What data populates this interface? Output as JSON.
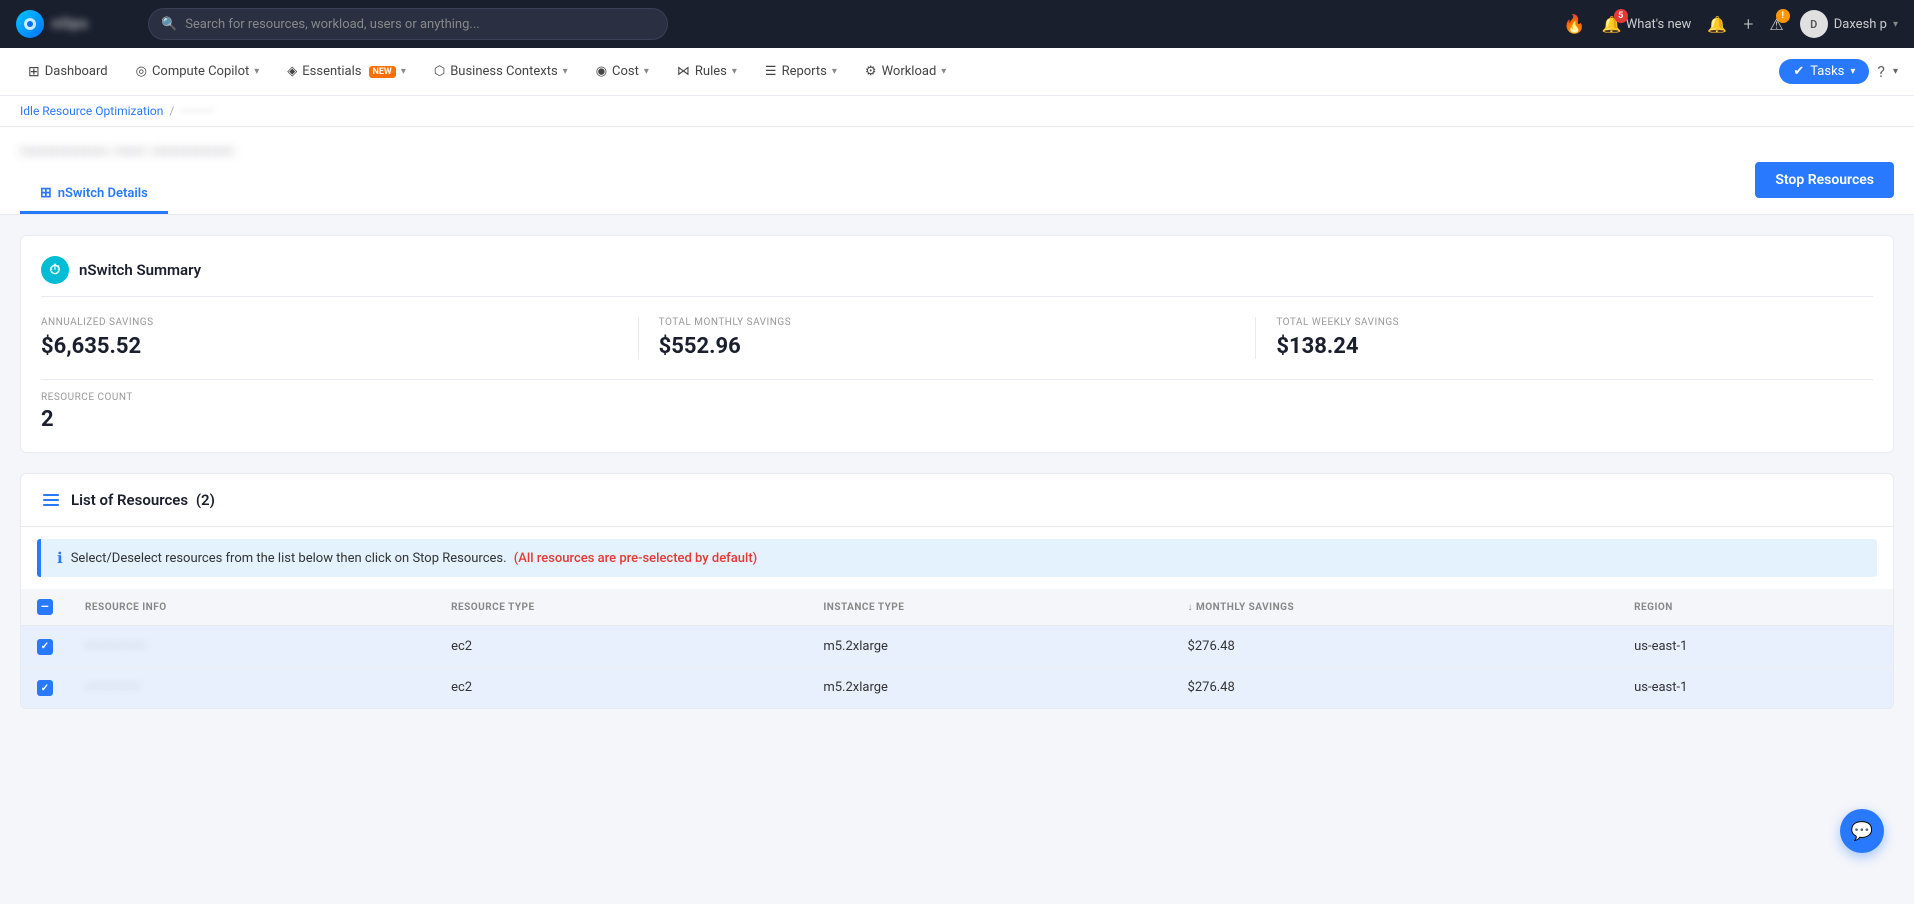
{
  "topNav": {
    "searchPlaceholder": "Search for resources, workload, users or anything...",
    "whatsNew": "What's new",
    "notifBadge": "5",
    "userName": "Daxesh p",
    "tasksLabel": "Tasks"
  },
  "secNav": {
    "items": [
      {
        "id": "dashboard",
        "label": "Dashboard",
        "icon": "⊞",
        "hasDropdown": false,
        "badge": ""
      },
      {
        "id": "compute-copilot",
        "label": "Compute Copilot",
        "icon": "◎",
        "hasDropdown": true,
        "badge": ""
      },
      {
        "id": "essentials",
        "label": "Essentials",
        "icon": "◈",
        "hasDropdown": true,
        "badge": "NEW"
      },
      {
        "id": "business-contexts",
        "label": "Business Contexts",
        "icon": "⬡",
        "hasDropdown": true,
        "badge": ""
      },
      {
        "id": "cost",
        "label": "Cost",
        "icon": "◉",
        "hasDropdown": true,
        "badge": ""
      },
      {
        "id": "rules",
        "label": "Rules",
        "icon": "⋈",
        "hasDropdown": true,
        "badge": ""
      },
      {
        "id": "reports",
        "label": "Reports",
        "icon": "☰",
        "hasDropdown": true,
        "badge": ""
      },
      {
        "id": "workload",
        "label": "Workload",
        "icon": "⚙",
        "hasDropdown": true,
        "badge": ""
      }
    ],
    "tasksLabel": "Tasks"
  },
  "breadcrumb": {
    "parent": "Idle Resource Optimization",
    "current": "···········"
  },
  "pageHeader": {
    "title": "·············· ····· ·············",
    "stopResourcesLabel": "Stop Resources",
    "tab": {
      "icon": "⊞",
      "label": "nSwitch Details"
    }
  },
  "summary": {
    "sectionTitle": "nSwitch Summary",
    "metrics": [
      {
        "label": "ANNUALIZED SAVINGS",
        "value": "$6,635.52"
      },
      {
        "label": "TOTAL MONTHLY SAVINGS",
        "value": "$552.96"
      },
      {
        "label": "TOTAL WEEKLY SAVINGS",
        "value": "$138.24"
      }
    ],
    "resourceCountLabel": "RESOURCE COUNT",
    "resourceCountValue": "2"
  },
  "resources": {
    "sectionTitle": "List of Resources",
    "resourceCount": "(2)",
    "infoBanner": "Select/Deselect resources from the list below then click on Stop Resources.",
    "infoBannerHighlight": "(All resources are pre-selected by default)",
    "tableHeaders": [
      {
        "id": "resource-info",
        "label": "RESOURCE INFO"
      },
      {
        "id": "resource-type",
        "label": "RESOURCE TYPE"
      },
      {
        "id": "instance-type",
        "label": "INSTANCE TYPE"
      },
      {
        "id": "monthly-savings",
        "label": "↓ MONTHLY SAVINGS"
      },
      {
        "id": "region",
        "label": "REGION"
      }
    ],
    "rows": [
      {
        "id": "row-1",
        "resourceName": "··················",
        "resourceType": "ec2",
        "instanceType": "m5.2xlarge",
        "monthlySavings": "$276.48",
        "region": "us-east-1",
        "selected": true
      },
      {
        "id": "row-2",
        "resourceName": "················",
        "resourceType": "ec2",
        "instanceType": "m5.2xlarge",
        "monthlySavings": "$276.48",
        "region": "us-east-1",
        "selected": true
      }
    ]
  }
}
